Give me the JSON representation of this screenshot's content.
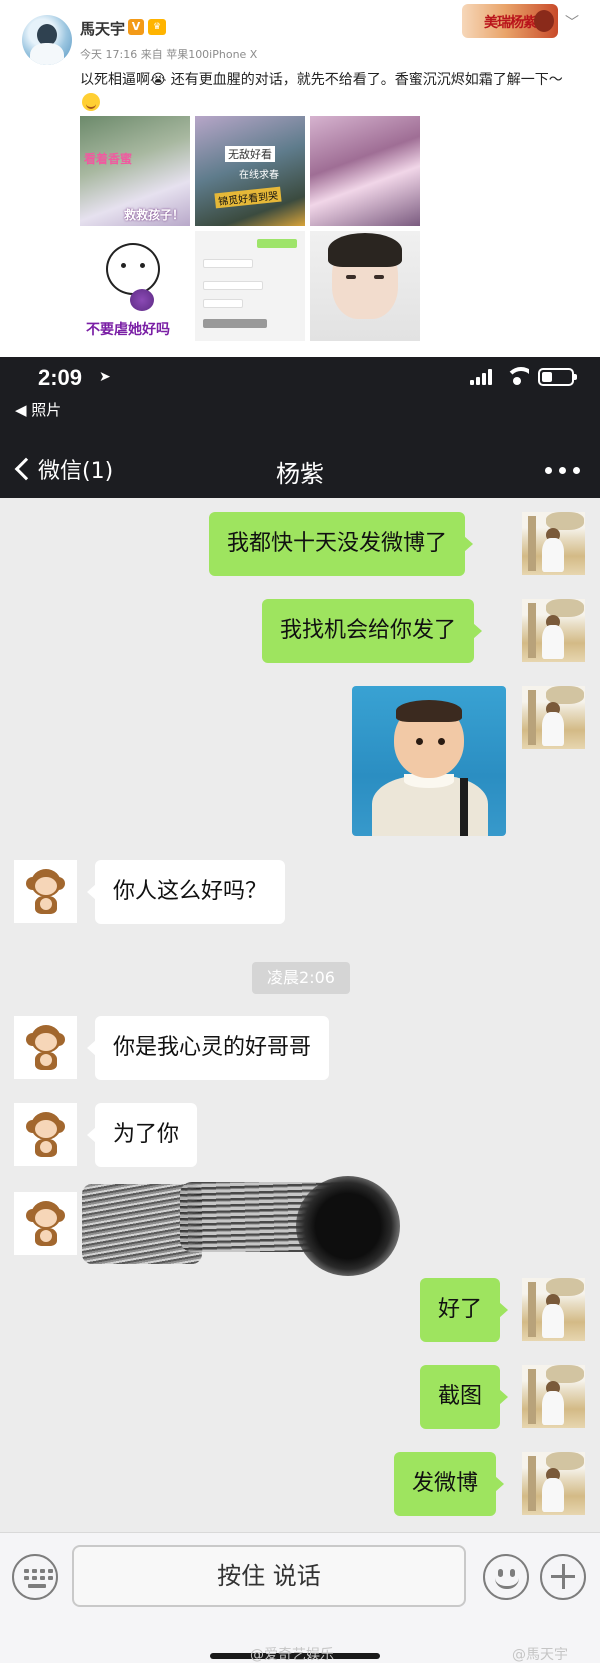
{
  "weibo": {
    "username": "馬天宇",
    "meta": "今天 17:16 来自 苹果100iPhone X",
    "text": "以死相逼啊😭 还有更血腥的对话，就先不给看了。香蜜沉沉烬如霜了解一下～",
    "badge_text": "美瑞杨紫",
    "images": [
      {
        "caption": "看着香蜜，救救孩子！"
      },
      {
        "caption": "无敌好看 在线求春 锦觅好看到哭"
      },
      {
        "caption": ""
      },
      {
        "caption": "不要虐她好吗"
      },
      {
        "caption": ""
      },
      {
        "caption": ""
      }
    ]
  },
  "status_bar": {
    "time": "2:09",
    "back_app": "◀ 照片"
  },
  "nav": {
    "back_label": "微信(1)",
    "title": "杨紫",
    "more_icon": "more-icon"
  },
  "chat": {
    "messages": [
      {
        "from": "me",
        "type": "text",
        "text": "我都快十天没发微博了"
      },
      {
        "from": "me",
        "type": "text",
        "text": "我找机会给你发了"
      },
      {
        "from": "me",
        "type": "image",
        "text": ""
      },
      {
        "from": "them",
        "type": "text",
        "text": "你人这么好吗？"
      },
      {
        "from": "them",
        "type": "text",
        "text": "你是我心灵的好哥哥"
      },
      {
        "from": "them",
        "type": "text",
        "text": "为了你"
      },
      {
        "from": "them",
        "type": "redacted",
        "text": ""
      },
      {
        "from": "me",
        "type": "text",
        "text": "好了"
      },
      {
        "from": "me",
        "type": "text",
        "text": "截图"
      },
      {
        "from": "me",
        "type": "text",
        "text": "发微博"
      }
    ],
    "timestamp": "凌晨2:06"
  },
  "input_bar": {
    "talk_label": "按住 说话"
  },
  "watermarks": {
    "left": "@爱奇艺娱乐",
    "right": "@馬天宇"
  },
  "colors": {
    "nav_bg": "#1c1d21",
    "chat_bg": "#ececec",
    "my_bubble": "#9ee45f",
    "their_bubble": "#ffffff"
  }
}
